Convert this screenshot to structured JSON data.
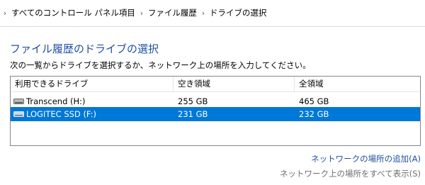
{
  "breadcrumb": {
    "items": [
      "すべてのコントロール パネル項目",
      "ファイル履歴",
      "ドライブの選択"
    ]
  },
  "page": {
    "title": "ファイル履歴のドライブの選択",
    "instruction": "次の一覧からドライブを選択するか、ネットワーク上の場所を入力してください。"
  },
  "drive_list": {
    "columns": [
      "利用できるドライブ",
      "空き領域",
      "全領域"
    ],
    "rows": [
      {
        "name": "Transcend (H:)",
        "free": "255 GB",
        "total": "465 GB",
        "selected": false
      },
      {
        "name": "LOGITEC SSD (F:)",
        "free": "231 GB",
        "total": "232 GB",
        "selected": true
      }
    ]
  },
  "links": {
    "add_network": "ネットワークの場所の追加(A)",
    "show_all_network": "ネットワーク上の場所をすべて表示(S)"
  },
  "colors": {
    "title": "#1e50a2",
    "selection": "#0078d7",
    "link": "#1e50a2",
    "disabled_link": "#6d6d6d"
  },
  "icons": {
    "breadcrumb_separator": "chevron-right-icon",
    "drive": "drive-icon"
  }
}
